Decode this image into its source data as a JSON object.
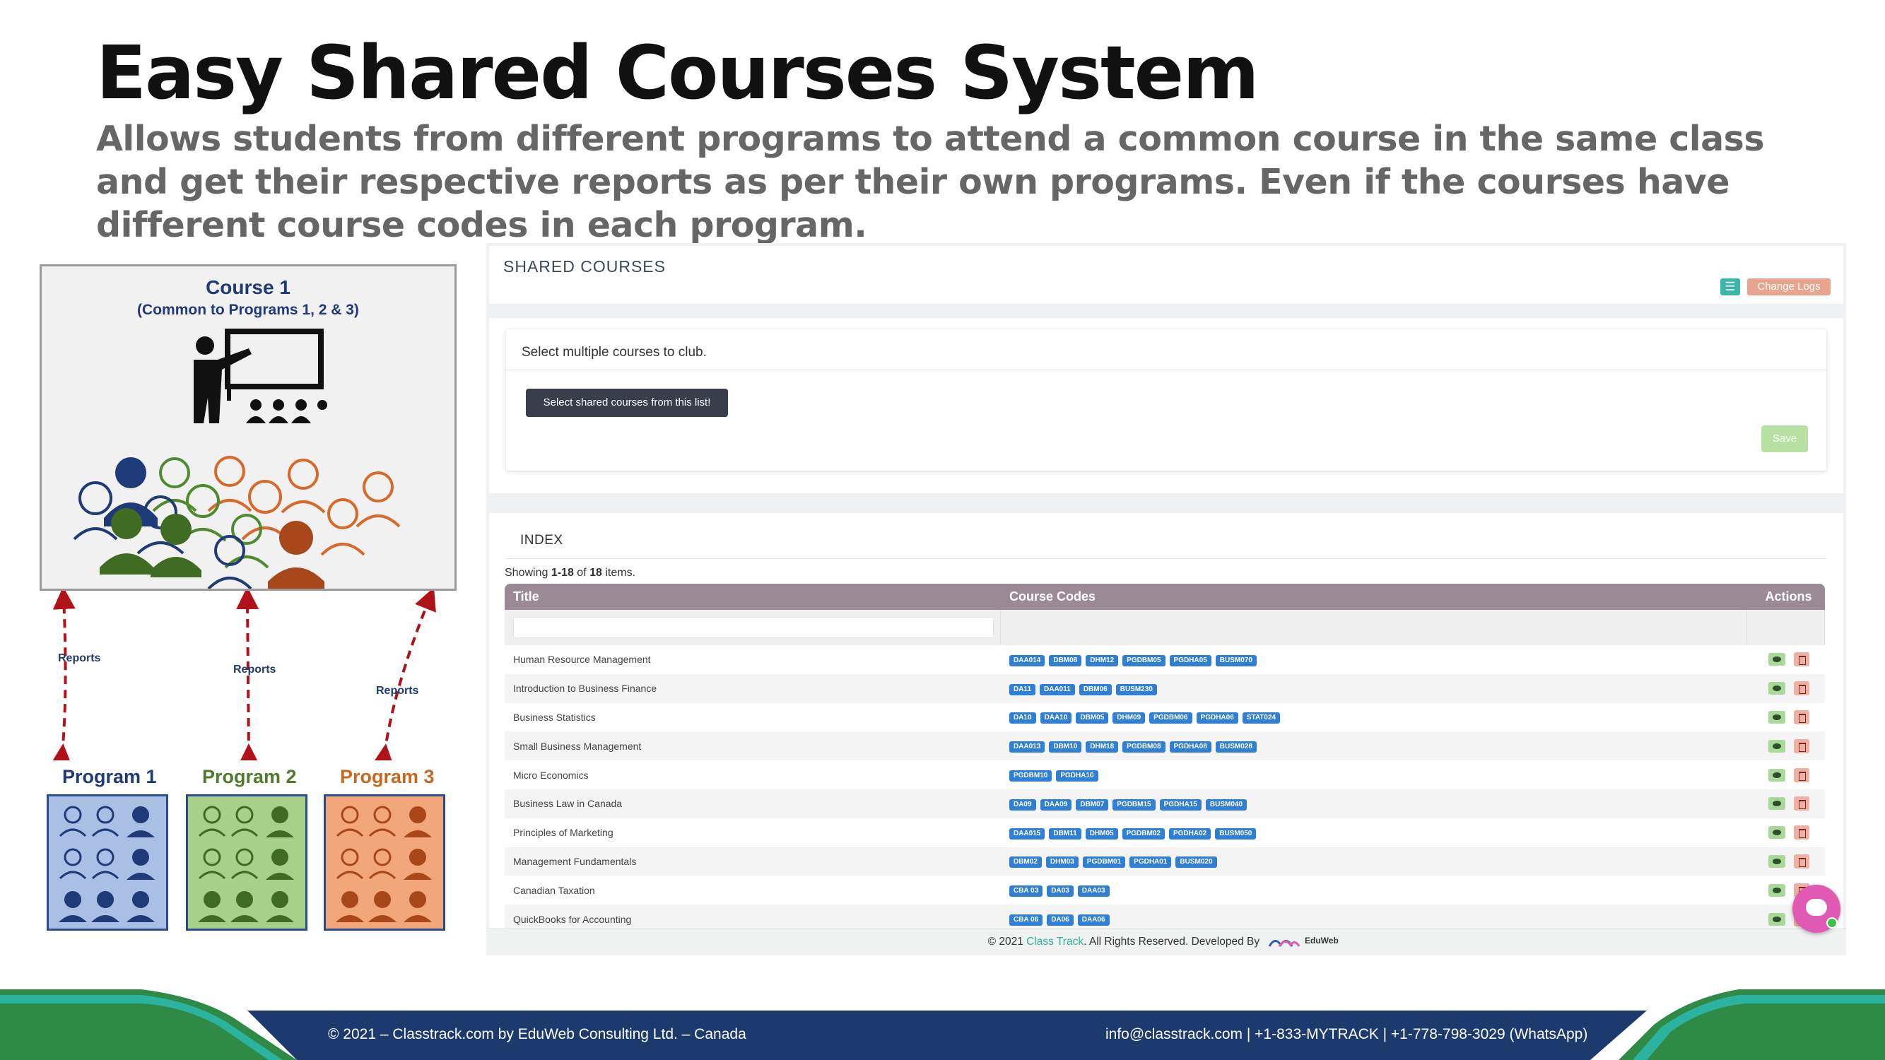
{
  "slide": {
    "title": "Easy Shared Courses System",
    "subtitle": "Allows students from different programs to attend a common course in the same class and get their respective reports as per their own programs. Even if the courses have different course codes in each program."
  },
  "illustration": {
    "course_title": "Course 1",
    "course_subtitle": "(Common to Programs 1, 2 & 3)",
    "report_labels": [
      "Reports",
      "Reports",
      "Reports"
    ],
    "programs": [
      {
        "label": "Program 1",
        "color": "#1f3a78",
        "fill": "#a9bfe3"
      },
      {
        "label": "Program 2",
        "color": "#4f7b2a",
        "fill": "#a7d08a"
      },
      {
        "label": "Program 3",
        "color": "#c8671e",
        "fill": "#f2a77a"
      }
    ]
  },
  "app": {
    "panel_title": "SHARED COURSES",
    "list_icon": "list-icon",
    "change_logs_label": "Change Logs",
    "select_heading": "Select multiple courses to club.",
    "select_button_label": "Select shared courses from this list!",
    "save_label": "Save",
    "index_title": "INDEX",
    "showing": {
      "prefix": "Showing ",
      "range": "1-18",
      "middle": " of ",
      "total": "18",
      "suffix": " items."
    },
    "columns": [
      "Title",
      "Course Codes",
      "Actions"
    ],
    "rows": [
      {
        "title": "Human Resource Management",
        "codes": [
          "DAA014",
          "DBM08",
          "DHM12",
          "PGDBM05",
          "PGDHA05",
          "BUSM070"
        ]
      },
      {
        "title": "Introduction to Business Finance",
        "codes": [
          "DA11",
          "DAA011",
          "DBM06",
          "BUSM230"
        ]
      },
      {
        "title": "Business Statistics",
        "codes": [
          "DA10",
          "DAA10",
          "DBM05",
          "DHM09",
          "PGDBM06",
          "PGDHA06",
          "STAT024"
        ]
      },
      {
        "title": "Small Business Management",
        "codes": [
          "DAA013",
          "DBM10",
          "DHM18",
          "PGDBM08",
          "PGDHA08",
          "BUSM028"
        ]
      },
      {
        "title": "Micro Economics",
        "codes": [
          "PGDBM10",
          "PGDHA10"
        ]
      },
      {
        "title": "Business Law in Canada",
        "codes": [
          "DA09",
          "DAA09",
          "DBM07",
          "PGDBM15",
          "PGDHA15",
          "BUSM040"
        ]
      },
      {
        "title": "Principles of Marketing",
        "codes": [
          "DAA015",
          "DBM11",
          "DHM05",
          "PGDBM02",
          "PGDHA02",
          "BUSM050"
        ]
      },
      {
        "title": "Management Fundamentals",
        "codes": [
          "DBM02",
          "DHM03",
          "PGDBM01",
          "PGDHA01",
          "BUSM020"
        ]
      },
      {
        "title": "Canadian Taxation",
        "codes": [
          "CBA 03",
          "DA03",
          "DAA03"
        ]
      },
      {
        "title": "QuickBooks for Accounting",
        "codes": [
          "CBA 06",
          "DA06",
          "DAA06"
        ]
      }
    ],
    "footer": {
      "prefix": "© 2021 ",
      "brand": "Class Track",
      "suffix": ". All Rights Reserved. Developed By",
      "logo_text": "EduWeb"
    }
  },
  "page_footer": {
    "left": "© 2021 – Classtrack.com by EduWeb Consulting Ltd. – Canada",
    "right": "info@classtrack.com | +1-833-MYTRACK | +1-778-798-3029 (WhatsApp)"
  },
  "colors": {
    "teal": "#2bb3a0",
    "navy": "#1d3a6e",
    "green": "#2e8a45",
    "pink": "#e05ab3"
  }
}
